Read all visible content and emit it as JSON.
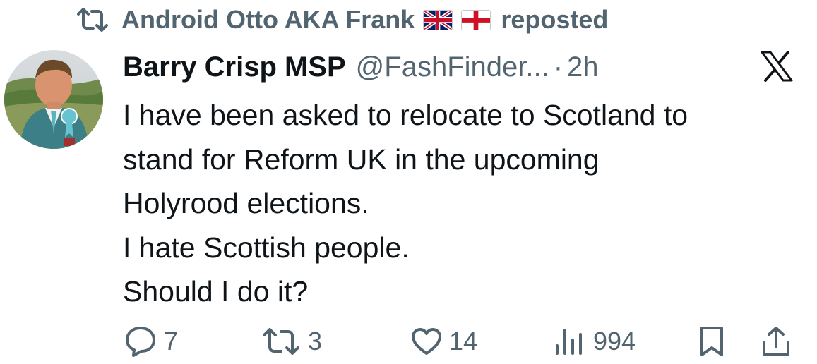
{
  "repost": {
    "user": "Android Otto AKA Frank",
    "flags": [
      "uk-flag-icon",
      "england-flag-icon"
    ],
    "label": "reposted"
  },
  "author": {
    "name": "Barry Crisp MSP",
    "handle": "@FashFinder...",
    "separator": "·",
    "time": "2h"
  },
  "tweet": {
    "lines": [
      "I have been asked to relocate to Scotland to",
      "stand for Reform UK in the upcoming",
      "Holyrood elections.",
      "I hate Scottish people.",
      "Should I do it?"
    ]
  },
  "actions": {
    "replies": "7",
    "reposts": "3",
    "likes": "14",
    "views": "994"
  },
  "icons": {
    "repost": "repost-icon",
    "reply": "reply-icon",
    "like": "heart-icon",
    "views": "views-icon",
    "bookmark": "bookmark-icon",
    "share": "share-icon",
    "brand": "x-logo-icon"
  },
  "colors": {
    "text": "#0f1419",
    "secondary": "#536471",
    "background": "#ffffff"
  }
}
